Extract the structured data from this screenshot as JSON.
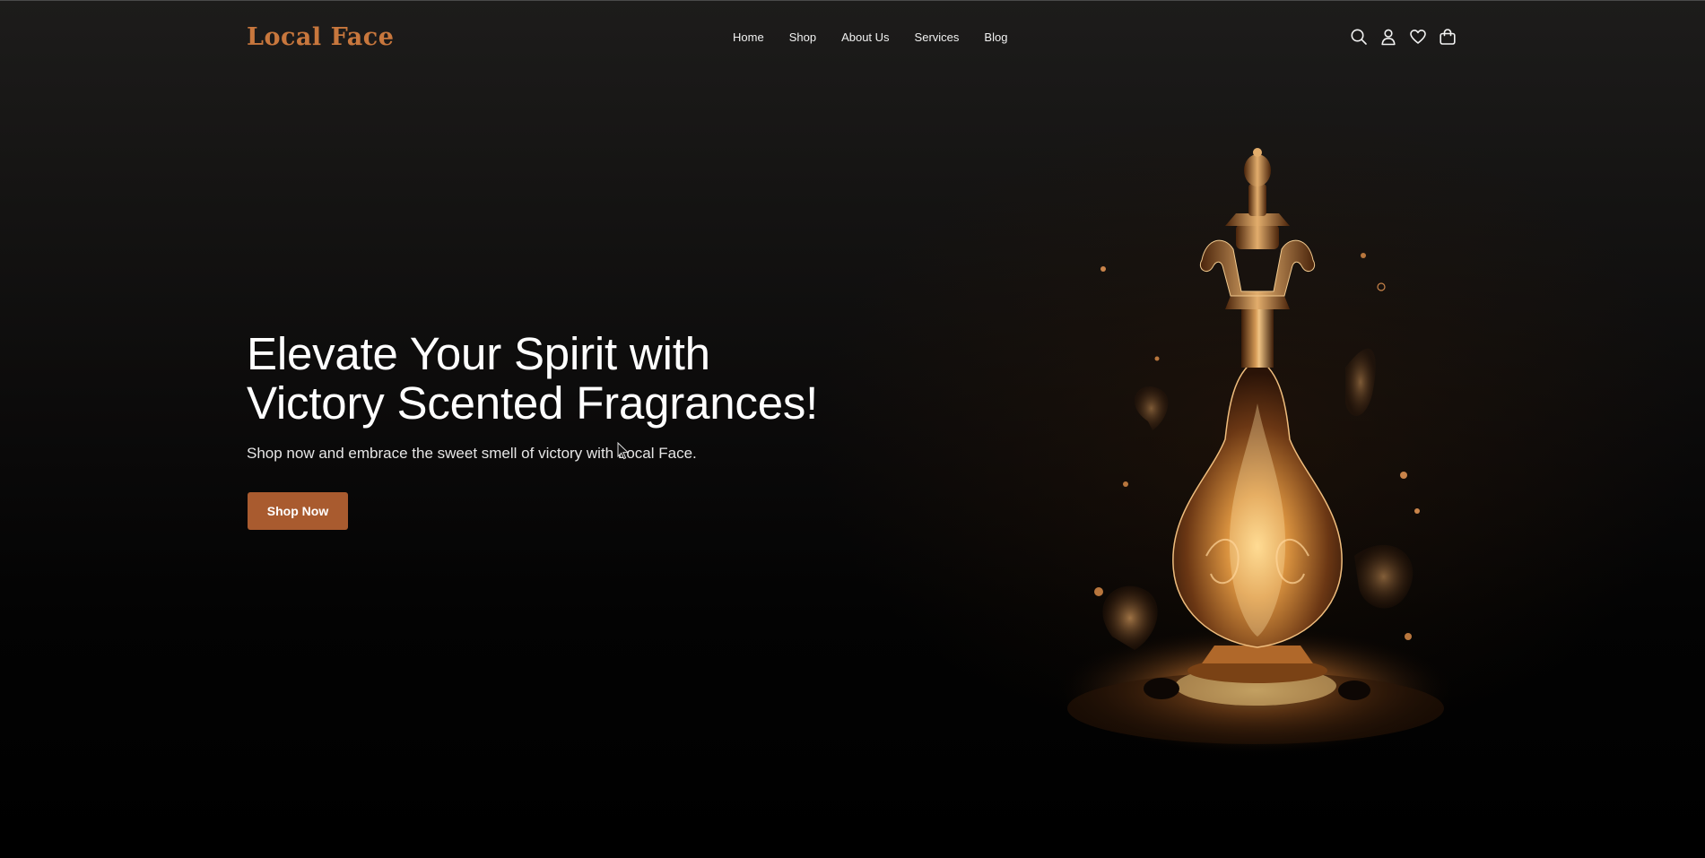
{
  "brand": {
    "name": "Local Face",
    "accent_color": "#c8773d",
    "button_color": "#a95b2f"
  },
  "nav": {
    "items": [
      {
        "label": "Home"
      },
      {
        "label": "Shop"
      },
      {
        "label": "About Us"
      },
      {
        "label": "Services"
      },
      {
        "label": "Blog"
      }
    ]
  },
  "header_icons": [
    "search-icon",
    "user-icon",
    "heart-icon",
    "bag-icon"
  ],
  "hero": {
    "headline_line1": "Elevate Your Spirit with",
    "headline_line2": "Victory Scented Fragrances!",
    "subtext": "Shop now and embrace the sweet smell of victory with Local Face.",
    "cta_label": "Shop Now",
    "image": "perfume-bottle-image"
  }
}
